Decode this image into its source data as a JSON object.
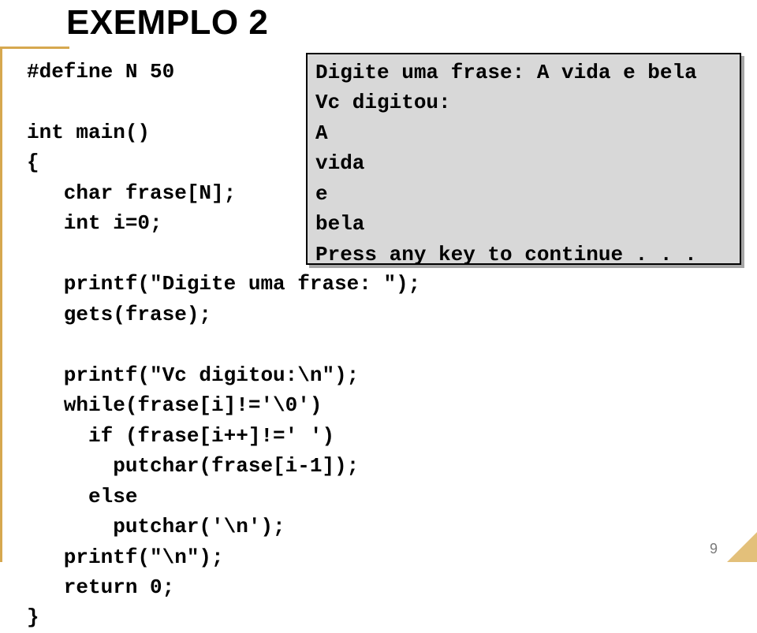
{
  "title": "EXEMPLO 2",
  "code": "#define N 50\n\nint main()\n{\n   char frase[N];\n   int i=0;\n\n   printf(\"Digite uma frase: \");\n   gets(frase);\n\n   printf(\"Vc digitou:\\n\");\n   while(frase[i]!='\\0')\n     if (frase[i++]!=' ')\n       putchar(frase[i-1]);\n     else\n       putchar('\\n');\n   printf(\"\\n\");\n   return 0;\n}",
  "output": "Digite uma frase: A vida e bela\nVc digitou:\nA\nvida\ne\nbela\nPress any key to continue . . .",
  "page_number": "9"
}
